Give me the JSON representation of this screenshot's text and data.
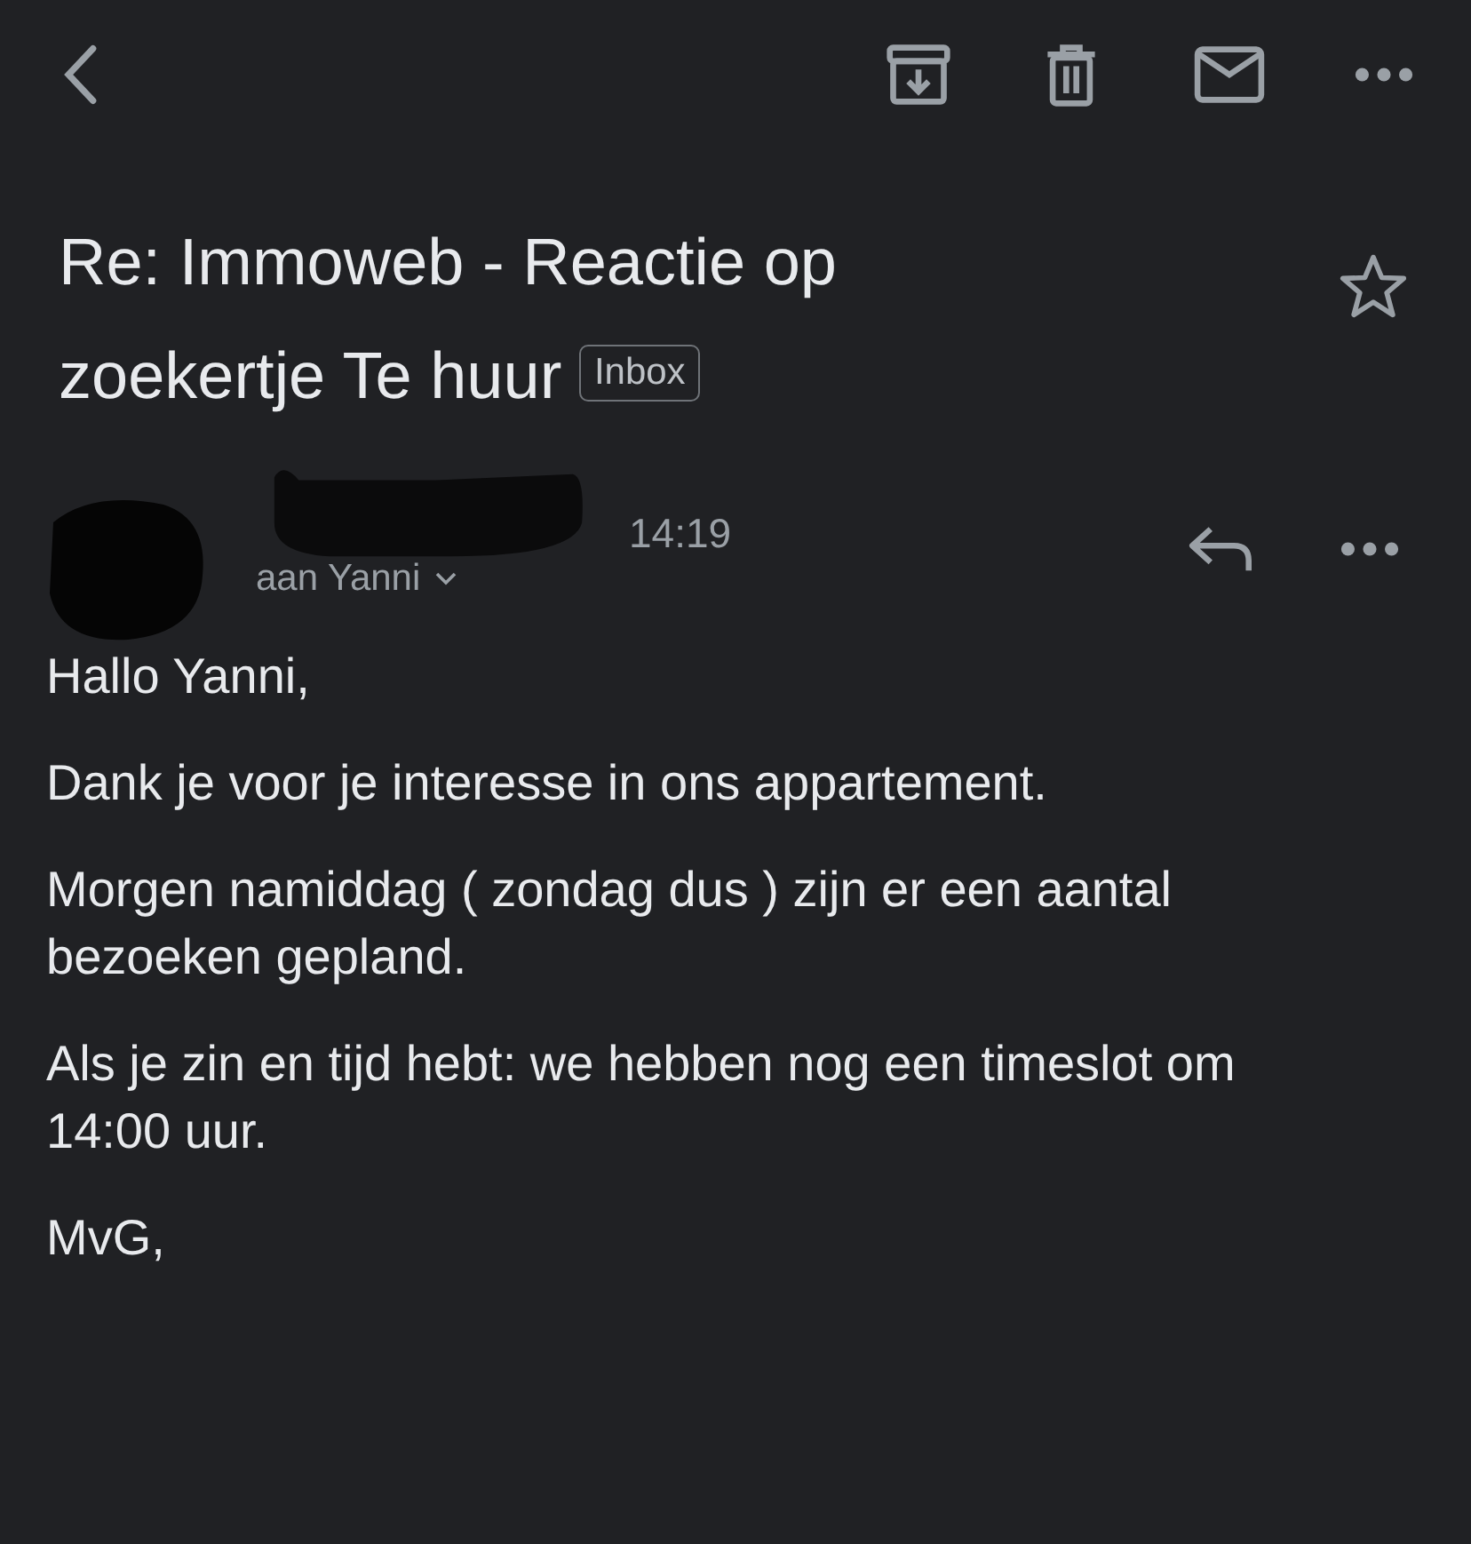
{
  "subject": {
    "title": "Re: Immoweb - Reactie op zoekertje Te huur",
    "label": "Inbox",
    "starred": false
  },
  "message": {
    "time": "14:19",
    "recipient": "aan Yanni"
  },
  "body": [
    "Hallo Yanni,",
    "Dank je voor je interesse in ons appartement.",
    "Morgen namiddag ( zondag dus ) zijn er een aantal bezoeken gepland.",
    "Als je zin en tijd hebt: we hebben nog een timeslot om 14:00 uur.",
    "MvG,"
  ]
}
